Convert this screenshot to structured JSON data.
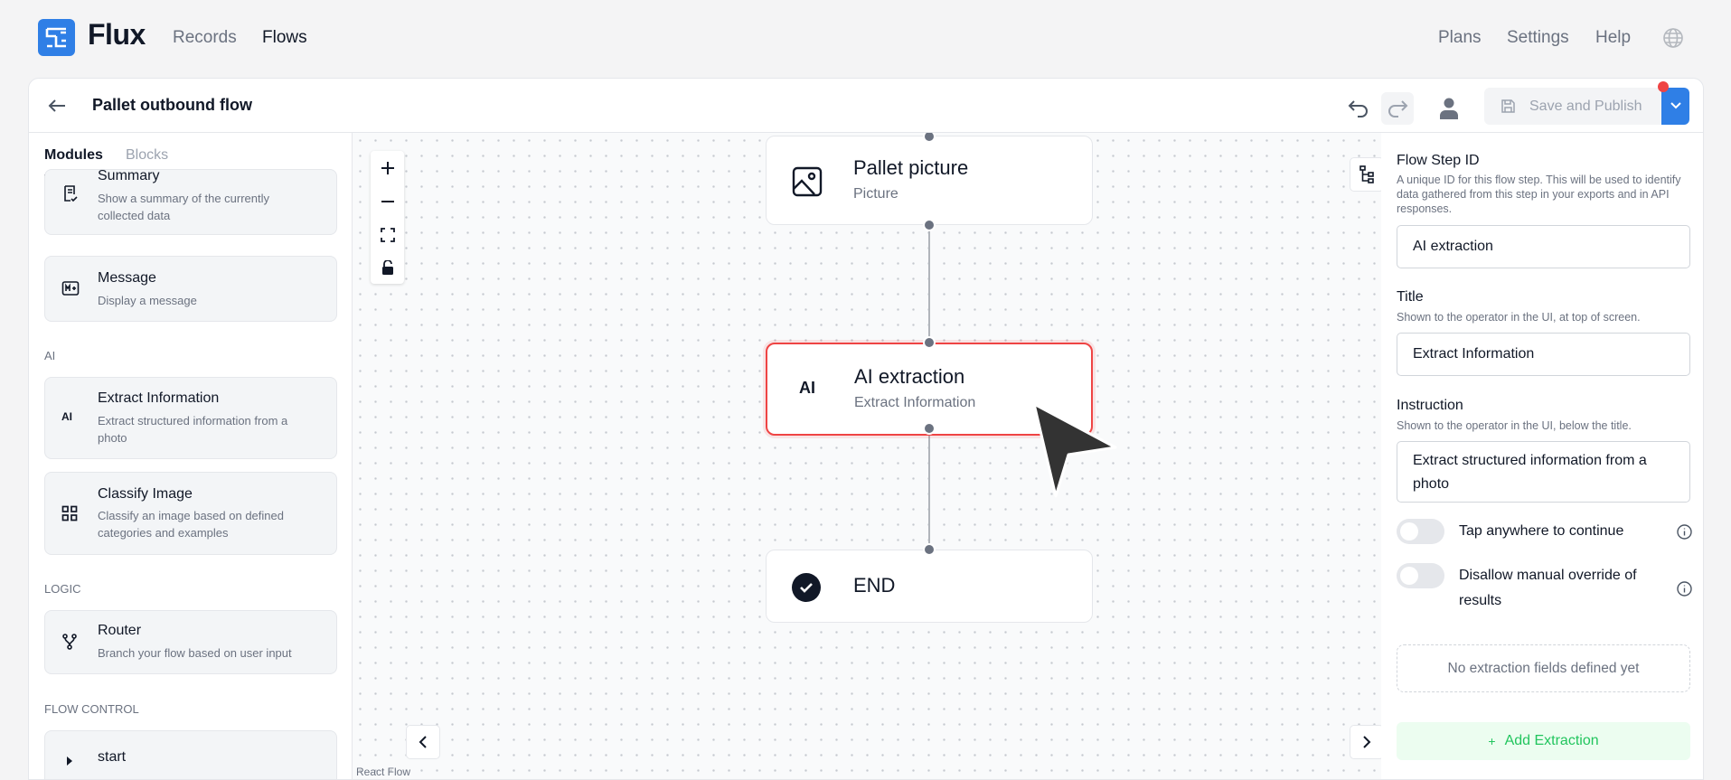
{
  "nav": {
    "brand": "Flux",
    "links": [
      "Records",
      "Flows"
    ],
    "right_links": [
      "Plans",
      "Settings",
      "Help"
    ]
  },
  "header": {
    "title": "Pallet outbound flow",
    "save_label": "Save and Publish"
  },
  "sidebar": {
    "tabs": [
      "Modules",
      "Blocks"
    ],
    "summary": {
      "title": "Summary",
      "desc": "Show a summary of the currently collected data"
    },
    "message": {
      "title": "Message",
      "desc": "Display a message"
    },
    "section_ai": "AI",
    "extract": {
      "title": "Extract Information",
      "desc": "Extract structured information from a photo"
    },
    "classify": {
      "title": "Classify Image",
      "desc": "Classify an image based on defined categories and examples"
    },
    "section_logic": "LOGIC",
    "router": {
      "title": "Router",
      "desc": "Branch your flow based on user input"
    },
    "section_flow": "FLOW CONTROL",
    "start": {
      "title": "start"
    }
  },
  "canvas": {
    "nodes": {
      "pallet": {
        "title": "Pallet picture",
        "subtitle": "Picture"
      },
      "ai": {
        "icon_text": "AI",
        "title": "AI extraction",
        "subtitle": "Extract Information"
      },
      "end": {
        "title": "END"
      }
    },
    "attribution": "React Flow"
  },
  "panel": {
    "step_id_label": "Flow Step ID",
    "step_id_help": "A unique ID for this flow step. This will be used to identify data gathered from this step in your exports and in API responses.",
    "step_id_value": "AI extraction",
    "title_label": "Title",
    "title_help": "Shown to the operator in the UI, at top of screen.",
    "title_value": "Extract Information",
    "instruction_label": "Instruction",
    "instruction_help": "Shown to the operator in the UI, below the title.",
    "instruction_value": "Extract structured information from a photo",
    "toggle1": "Tap anywhere to continue",
    "toggle2": "Disallow manual override of results",
    "empty_text": "No extraction fields defined yet",
    "add_label": "Add Extraction",
    "add_icon": "+"
  },
  "colors": {
    "accent": "#2f7fe6",
    "selected_border": "#ef4444",
    "add_green": "#22c55e"
  }
}
